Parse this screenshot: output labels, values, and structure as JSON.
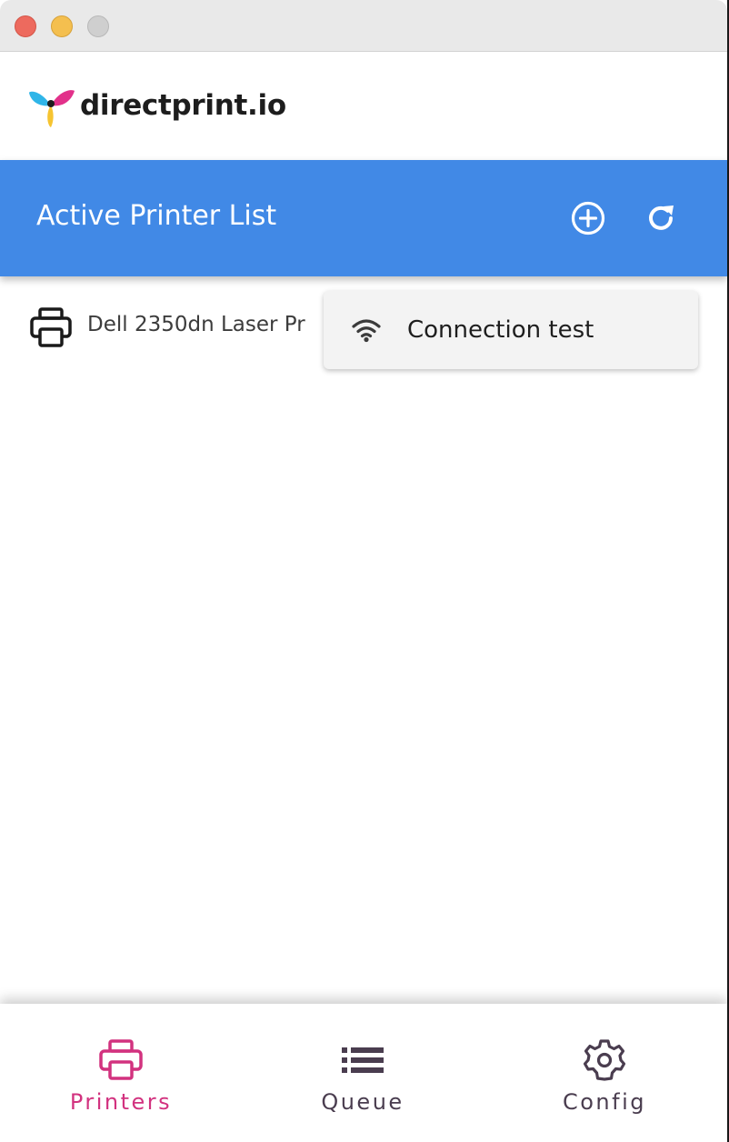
{
  "window": {
    "controls": [
      "close",
      "minimize",
      "maximize"
    ]
  },
  "brand": {
    "name": "directprint.io",
    "logo_icon": "butterfly-logo-icon"
  },
  "appbar": {
    "title": "Active Printer List",
    "actions": [
      {
        "name": "add",
        "icon": "add-circle-icon"
      },
      {
        "name": "refresh",
        "icon": "refresh-icon"
      }
    ],
    "color": "#4189e6"
  },
  "printers": [
    {
      "name": "Dell 2350dn Laser Pr",
      "icon": "printer-icon"
    }
  ],
  "context_menu": {
    "items": [
      {
        "label": "Connection test",
        "icon": "wifi-icon"
      }
    ]
  },
  "bottom_nav": {
    "items": [
      {
        "label": "Printers",
        "icon": "printer-icon",
        "active": true
      },
      {
        "label": "Queue",
        "icon": "list-icon",
        "active": false
      },
      {
        "label": "Config",
        "icon": "gear-icon",
        "active": false
      }
    ],
    "active_color": "#d2327f",
    "inactive_color": "#4a3d4f"
  }
}
